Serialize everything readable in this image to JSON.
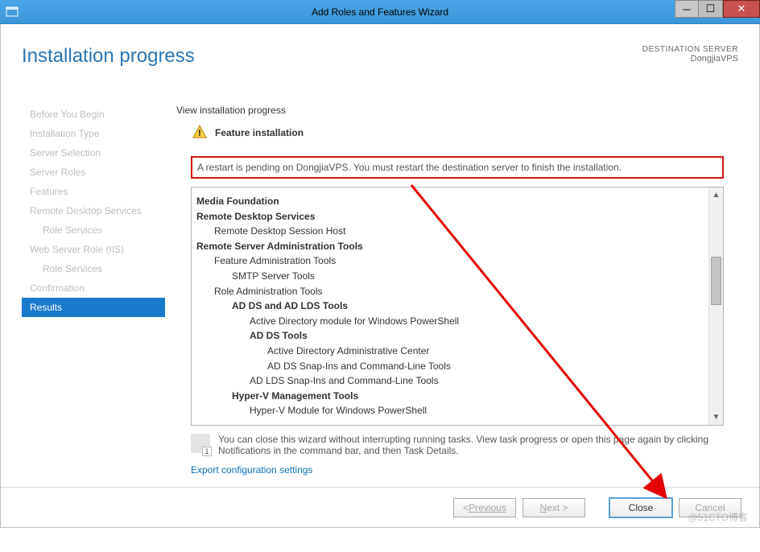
{
  "window": {
    "title": "Add Roles and Features Wizard"
  },
  "header": {
    "page_title": "Installation progress",
    "dest_label": "DESTINATION SERVER",
    "dest_value": "DongjiaVPS"
  },
  "sidebar": {
    "steps": [
      {
        "label": "Before You Begin",
        "sub": false
      },
      {
        "label": "Installation Type",
        "sub": false
      },
      {
        "label": "Server Selection",
        "sub": false
      },
      {
        "label": "Server Roles",
        "sub": false
      },
      {
        "label": "Features",
        "sub": false
      },
      {
        "label": "Remote Desktop Services",
        "sub": false
      },
      {
        "label": "Role Services",
        "sub": true
      },
      {
        "label": "Web Server Role (IIS)",
        "sub": false
      },
      {
        "label": "Role Services",
        "sub": true
      },
      {
        "label": "Confirmation",
        "sub": false
      },
      {
        "label": "Results",
        "sub": false,
        "active": true
      }
    ]
  },
  "main": {
    "subtitle": "View installation progress",
    "feature_row": "Feature installation",
    "restart_msg": "A restart is pending on DongjiaVPS. You must restart the destination server to finish the installation.",
    "tree": [
      {
        "label": "Media Foundation",
        "cls": "l0"
      },
      {
        "label": "Remote Desktop Services",
        "cls": "l0"
      },
      {
        "label": "Remote Desktop Session Host",
        "cls": "l1n"
      },
      {
        "label": "Remote Server Administration Tools",
        "cls": "l0"
      },
      {
        "label": "Feature Administration Tools",
        "cls": "l1n"
      },
      {
        "label": "SMTP Server Tools",
        "cls": "l2n"
      },
      {
        "label": "Role Administration Tools",
        "cls": "l1n"
      },
      {
        "label": "AD DS and AD LDS Tools",
        "cls": "l2"
      },
      {
        "label": "Active Directory module for Windows PowerShell",
        "cls": "l3n"
      },
      {
        "label": "AD DS Tools",
        "cls": "l3"
      },
      {
        "label": "Active Directory Administrative Center",
        "cls": "l4n"
      },
      {
        "label": "AD DS Snap-Ins and Command-Line Tools",
        "cls": "l4n"
      },
      {
        "label": "AD LDS Snap-Ins and Command-Line Tools",
        "cls": "l3n"
      },
      {
        "label": "Hyper-V Management Tools",
        "cls": "l2"
      },
      {
        "label": "Hyper-V Module for Windows PowerShell",
        "cls": "l3n"
      }
    ],
    "hint": "You can close this wizard without interrupting running tasks. View task progress or open this page again by clicking Notifications in the command bar, and then Task Details.",
    "export_link": "Export configuration settings"
  },
  "footer": {
    "previous": "Previous",
    "next": "Next >",
    "close": "Close",
    "cancel": "Cancel"
  },
  "watermark": "@51CTO博客"
}
